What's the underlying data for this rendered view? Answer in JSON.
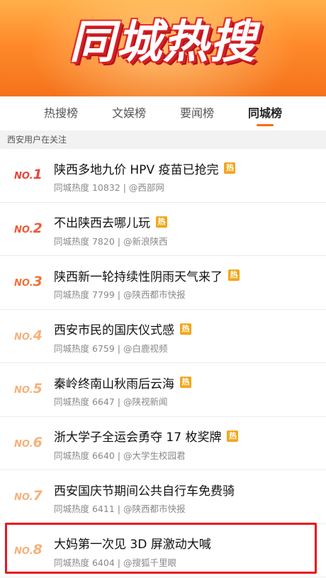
{
  "banner": {
    "title": "同城热搜"
  },
  "tabs": [
    {
      "label": "热搜榜",
      "active": false
    },
    {
      "label": "文娱榜",
      "active": false
    },
    {
      "label": "要闻榜",
      "active": false
    },
    {
      "label": "同城榜",
      "active": true
    }
  ],
  "section_label": "西安用户在关注",
  "items": [
    {
      "rank_prefix": "NO.",
      "rank_num": "1",
      "headline": "陕西多地九价 HPV 疫苗已抢完",
      "hot": "热",
      "meta": "同城热度 10832 | @西部网"
    },
    {
      "rank_prefix": "NO.",
      "rank_num": "2",
      "headline": "不出陕西去哪儿玩",
      "hot": "热",
      "meta": "同城热度 7820 | @新浪陕西"
    },
    {
      "rank_prefix": "NO.",
      "rank_num": "3",
      "headline": "陕西新一轮持续性阴雨天气来了",
      "hot": "热",
      "meta": "同城热度 7799 | @陕西都市快报"
    },
    {
      "rank_prefix": "NO.",
      "rank_num": "4",
      "headline": "西安市民的国庆仪式感",
      "hot": "热",
      "meta": "同城热度 6759 | @白鹿视频"
    },
    {
      "rank_prefix": "NO.",
      "rank_num": "5",
      "headline": "秦岭终南山秋雨后云海",
      "hot": "热",
      "meta": "同城热度 6647 | @陕视新闻"
    },
    {
      "rank_prefix": "NO.",
      "rank_num": "6",
      "headline": "浙大学子全运会勇夺 17 枚奖牌",
      "hot": "热",
      "meta": "同城热度 6640 | @大学生校园君"
    },
    {
      "rank_prefix": "NO.",
      "rank_num": "7",
      "headline": "西安国庆节期间公共自行车免费骑",
      "hot": "",
      "meta": "同城热度 6411 | @陕西都市快报"
    },
    {
      "rank_prefix": "NO.",
      "rank_num": "8",
      "headline": "大妈第一次见 3D 屏激动大喊",
      "hot": "",
      "meta": "同城热度 6404 | @搜狐千里眼"
    }
  ],
  "colors": {
    "accent": "#ff6a00",
    "hot_badge": "#f3a619",
    "highlight": "#e8171f"
  }
}
